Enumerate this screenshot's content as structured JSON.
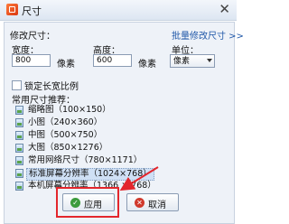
{
  "window": {
    "title": "尺寸",
    "close_glyph": "✕"
  },
  "header": {
    "section_label": "修改尺寸：",
    "batch_link": "批量修改尺寸 >>"
  },
  "size": {
    "width_label": "宽度：",
    "width_value": "800",
    "width_unit": "像素",
    "height_label": "高度：",
    "height_value": "600",
    "height_unit": "像素",
    "unit_label": "单位：",
    "unit_value": "像素"
  },
  "lock_ratio": {
    "label": "锁定长宽比例",
    "checked": false
  },
  "presets": {
    "title": "常用尺寸推荐：",
    "items": [
      {
        "label": "缩略图（100×150）",
        "icon": "image-icon"
      },
      {
        "label": "小图（240×360）",
        "icon": "image-icon"
      },
      {
        "label": "中图（500×750）",
        "icon": "image-icon"
      },
      {
        "label": "大图（850×1276）",
        "icon": "image-icon"
      },
      {
        "label": "常用网络尺寸（780×1171）",
        "icon": "image-icon"
      },
      {
        "label": "标准屏幕分辨率（1024×768）",
        "icon": "image-icon",
        "selected": true
      },
      {
        "label": "本机屏幕分辨率（1366 × 768）",
        "icon": "image-icon"
      }
    ]
  },
  "buttons": {
    "apply_label": "应用",
    "apply_icon_glyph": "✓",
    "cancel_label": "取消",
    "cancel_icon_glyph": "✕"
  },
  "colors": {
    "accent": "#1f57a8",
    "highlight": "#e3262c",
    "apply_icon": "#3c9b3c",
    "cancel_icon": "#d0392c"
  }
}
